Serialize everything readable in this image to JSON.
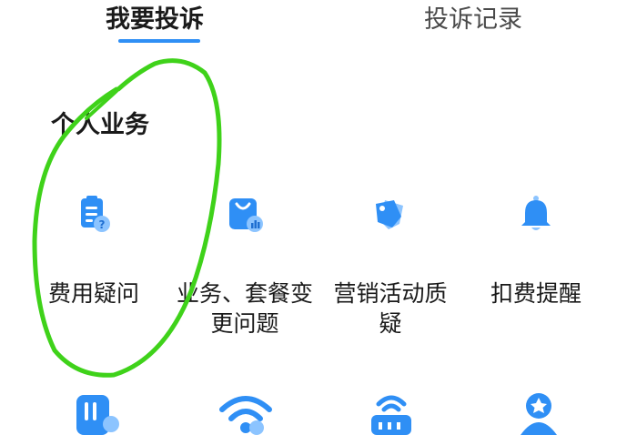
{
  "tabs": [
    {
      "label": "我要投诉",
      "active": true
    },
    {
      "label": "投诉记录",
      "active": false
    }
  ],
  "section": {
    "title": "个人业务"
  },
  "items": [
    {
      "label": "费用疑问",
      "icon": "bill-question-icon"
    },
    {
      "label": "业务、套餐变更问题",
      "icon": "shopping-bag-chart-icon"
    },
    {
      "label": "营销活动质疑",
      "icon": "price-tags-icon"
    },
    {
      "label": "扣费提醒",
      "icon": "bell-icon"
    }
  ],
  "next_row_icons": [
    "sim-card-icon",
    "wifi-signal-icon",
    "router-icon",
    "medal-user-icon"
  ],
  "colors": {
    "accent": "#2f8ff5",
    "accent_light": "#8cc4ff",
    "annotation": "#3fd21a",
    "text": "#1a1a1a"
  }
}
